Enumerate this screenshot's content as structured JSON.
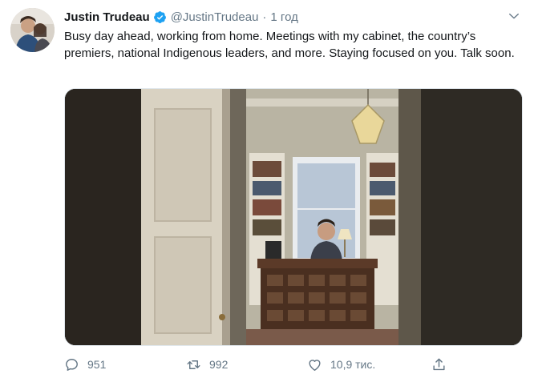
{
  "author": {
    "name": "Justin Trudeau",
    "handle": "@JustinTrudeau",
    "separator": "·",
    "time": "1 год"
  },
  "tweet": {
    "text": "Busy day ahead, working from home. Meetings with my cabinet, the country’s premiers, national Indigenous leaders, and more. Staying focused on you. Talk soon."
  },
  "actions": {
    "replies": "951",
    "retweets": "992",
    "likes": "10,9 тис."
  },
  "icons": {
    "verified": "verified-badge-icon",
    "menu": "chevron-down-icon",
    "reply": "comment-icon",
    "retweet": "retweet-icon",
    "like": "heart-icon",
    "share": "share-icon"
  },
  "colors": {
    "text": "#14171a",
    "secondary": "#657786",
    "verified": "#1da1f2",
    "border": "#e1e8ed"
  }
}
